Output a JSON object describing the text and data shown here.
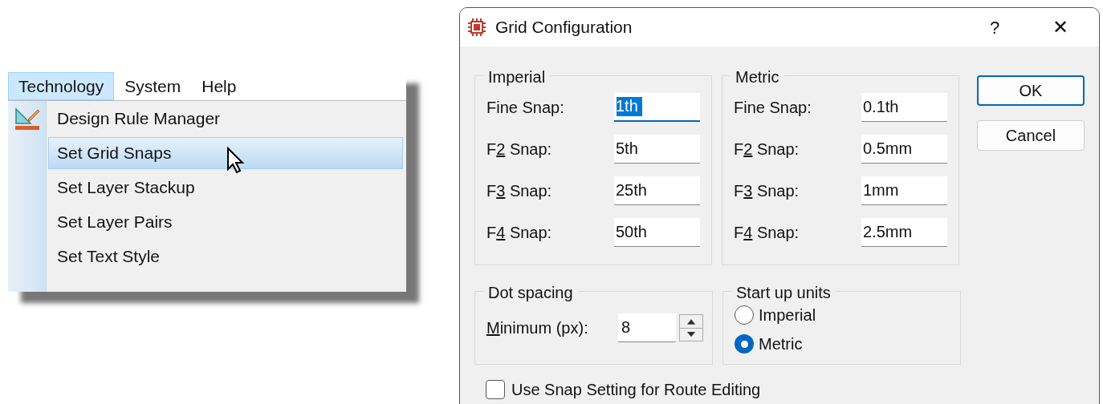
{
  "menu_bar": [
    {
      "label": "Technology",
      "selected": true
    },
    {
      "label": "System",
      "selected": false
    },
    {
      "label": "Help",
      "selected": false
    }
  ],
  "menu_items": [
    {
      "label": "Design Rule Manager",
      "icon": true,
      "selected": false
    },
    {
      "label": "Set Grid Snaps",
      "icon": false,
      "selected": true
    },
    {
      "label": "Set Layer Stackup",
      "icon": false,
      "selected": false
    },
    {
      "label": "Set Layer Pairs",
      "icon": false,
      "selected": false
    },
    {
      "label": "Set Text Style",
      "icon": false,
      "selected": false
    }
  ],
  "dialog": {
    "title": "Grid Configuration",
    "help": "?",
    "close": "✕",
    "groups": [
      {
        "title": "Imperial",
        "fields": [
          {
            "label": [
              {
                "text": "Fine Snap:",
                "underlined": false
              }
            ],
            "value": "1th",
            "focused": true
          },
          {
            "label": [
              {
                "text": "F",
                "underlined": false
              },
              {
                "text": "2",
                "underlined": true
              },
              {
                "text": " Snap:",
                "underlined": false
              }
            ],
            "value": "5th",
            "focused": false
          },
          {
            "label": [
              {
                "text": "F",
                "underlined": false
              },
              {
                "text": "3",
                "underlined": true
              },
              {
                "text": " Snap:",
                "underlined": false
              }
            ],
            "value": "25th",
            "focused": false
          },
          {
            "label": [
              {
                "text": "F",
                "underlined": false
              },
              {
                "text": "4",
                "underlined": true
              },
              {
                "text": " Snap:",
                "underlined": false
              }
            ],
            "value": "50th",
            "focused": false
          }
        ]
      },
      {
        "title": "Metric",
        "fields": [
          {
            "label": [
              {
                "text": "Fine Snap:",
                "underlined": false
              }
            ],
            "value": "0.1th",
            "focused": false
          },
          {
            "label": [
              {
                "text": "F",
                "underlined": false
              },
              {
                "text": "2",
                "underlined": true
              },
              {
                "text": " Snap:",
                "underlined": false
              }
            ],
            "value": "0.5mm",
            "focused": false
          },
          {
            "label": [
              {
                "text": "F",
                "underlined": false
              },
              {
                "text": "3",
                "underlined": true
              },
              {
                "text": " Snap:",
                "underlined": false
              }
            ],
            "value": "1mm",
            "focused": false
          },
          {
            "label": [
              {
                "text": "F",
                "underlined": false
              },
              {
                "text": "4",
                "underlined": true
              },
              {
                "text": " Snap:",
                "underlined": false
              }
            ],
            "value": "2.5mm",
            "focused": false
          }
        ]
      }
    ],
    "buttons": [
      {
        "label": "OK",
        "default": true
      },
      {
        "label": "Cancel",
        "default": false
      }
    ],
    "dot_spacing": {
      "title": "Dot spacing",
      "label": [
        {
          "text": "M",
          "underlined": true
        },
        {
          "text": "inimum (px):",
          "underlined": false
        }
      ],
      "value": "8"
    },
    "start_up_units": {
      "title": "Start up units",
      "options": [
        {
          "label": "Imperial",
          "selected": false
        },
        {
          "label": "Metric",
          "selected": true
        }
      ]
    },
    "route_checkbox": {
      "label": "Use Snap Setting for Route Editing",
      "checked": false
    }
  }
}
